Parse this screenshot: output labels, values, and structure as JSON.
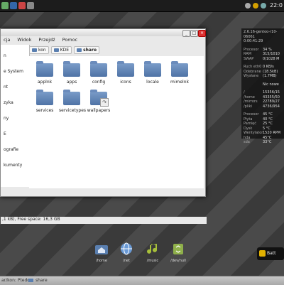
{
  "top_panel": {
    "clock": "22:0"
  },
  "conky": {
    "header": [
      "2.6.16-gentoo-r10-06061",
      "0:00:41:29"
    ],
    "rows": [
      {
        "k": "Procesor",
        "v": "34 %"
      },
      {
        "k": "RAM",
        "v": "315/1010"
      },
      {
        "k": "SWAP",
        "v": "0/1028 M"
      },
      {
        "k": "gap",
        "v": ""
      },
      {
        "k": "Ruch eth0",
        "v": "0 KB/s"
      },
      {
        "k": "Odebrane",
        "v": "(18.5kB)"
      },
      {
        "k": "Wysłane",
        "v": "(1.7MB)"
      },
      {
        "k": "gap",
        "v": ""
      },
      {
        "k": "",
        "v": "Nic nowe"
      },
      {
        "k": "gap",
        "v": ""
      },
      {
        "k": "/",
        "v": "15356/15"
      },
      {
        "k": "/home",
        "v": "43355/50"
      },
      {
        "k": "/mirrors",
        "v": "22789/27"
      },
      {
        "k": "/pliki",
        "v": "4736/954"
      },
      {
        "k": "gap",
        "v": ""
      },
      {
        "k": "Procesor",
        "v": "45 °C"
      },
      {
        "k": "Płyta",
        "v": "40 °C"
      },
      {
        "k": "Pamięć",
        "v": "25 °C"
      },
      {
        "k": "Dysk",
        "v": "5 °C"
      },
      {
        "k": "Wentylator",
        "v": "1520 RPM"
      },
      {
        "k": "hda",
        "v": "45°C"
      },
      {
        "k": "sda",
        "v": "33°C"
      }
    ]
  },
  "window": {
    "menu": [
      "cja",
      "Widok",
      "Przejdź",
      "Pomoc"
    ],
    "sidebar": [
      "n",
      "e System",
      "nt",
      "zyka",
      "ny",
      "E",
      "ografie",
      "kumenty"
    ],
    "crumbs": [
      "kon",
      "KDE",
      "share"
    ],
    "files": [
      {
        "name": "applnk",
        "link": false
      },
      {
        "name": "apps",
        "link": false
      },
      {
        "name": "config",
        "link": false
      },
      {
        "name": "icons",
        "link": false
      },
      {
        "name": "locale",
        "link": false
      },
      {
        "name": "mimelnk",
        "link": false
      },
      {
        "name": "services",
        "link": false
      },
      {
        "name": "servicetypes",
        "link": false
      },
      {
        "name": "wallpapers",
        "link": true
      }
    ],
    "status": ",1 kB), Free space: 16,3 GB"
  },
  "dock": [
    {
      "label": "/home",
      "icon": "home-folder-icon"
    },
    {
      "label": "/net",
      "icon": "network-globe-icon"
    },
    {
      "label": "/music",
      "icon": "music-note-icon"
    },
    {
      "label": "/dev/null",
      "icon": "trash-icon"
    }
  ],
  "bottombar": {
    "left": "ar/kon: Ptedo",
    "task": "share"
  },
  "notify": {
    "text": "Batt"
  },
  "colors": {
    "folder": "#5a7fb0",
    "close": "#d33",
    "panel": "#1c1c1c"
  }
}
